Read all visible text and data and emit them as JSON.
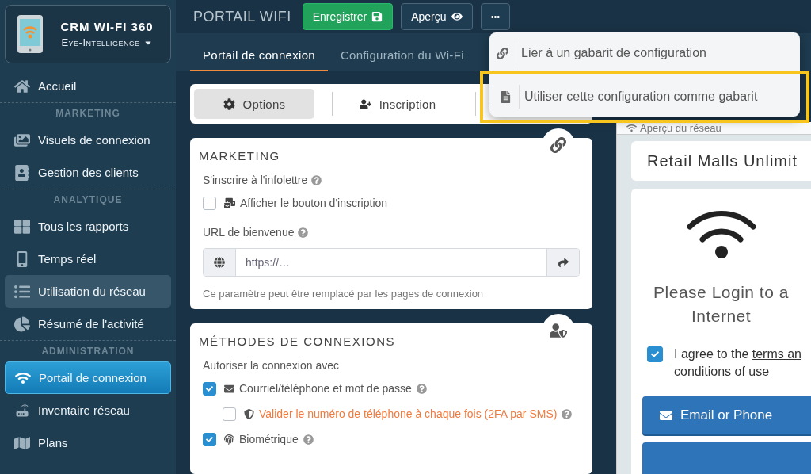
{
  "sidebar": {
    "brand": {
      "title": "CRM WI-FI 360",
      "org": "Eye-Intelligence"
    },
    "items": [
      {
        "kind": "item",
        "label": "Accueil",
        "selected": false,
        "hovered": false
      },
      {
        "kind": "section",
        "label": "MARKETING"
      },
      {
        "kind": "item",
        "label": "Visuels de connexion",
        "selected": false,
        "hovered": false
      },
      {
        "kind": "item",
        "label": "Gestion des clients",
        "selected": false,
        "hovered": false
      },
      {
        "kind": "section",
        "label": "ANALYTIQUE"
      },
      {
        "kind": "item",
        "label": "Tous les rapports",
        "selected": false,
        "hovered": false
      },
      {
        "kind": "item",
        "label": "Temps réel",
        "selected": false,
        "hovered": false
      },
      {
        "kind": "item",
        "label": "Utilisation du réseau",
        "selected": false,
        "hovered": true
      },
      {
        "kind": "item",
        "label": "Résumé de l'activité",
        "selected": false,
        "hovered": false
      },
      {
        "kind": "section",
        "label": "ADMINISTRATION"
      },
      {
        "kind": "item",
        "label": "Portail de connexion",
        "selected": true,
        "hovered": false
      },
      {
        "kind": "item",
        "label": "Inventaire réseau",
        "selected": false,
        "hovered": false
      },
      {
        "kind": "item",
        "label": "Plans",
        "selected": false,
        "hovered": false
      }
    ]
  },
  "header": {
    "title": "PORTAIL WIFI",
    "buttons": [
      {
        "kind": "save",
        "label": "Enregistrer"
      },
      {
        "kind": "preview",
        "label": "Aperçu"
      },
      {
        "kind": "more"
      }
    ]
  },
  "tabs": [
    {
      "label": "Portail de connexion",
      "selected": true
    },
    {
      "label": "Configuration du Wi-Fi",
      "selected": false
    }
  ],
  "menu": {
    "items": [
      {
        "label": "Lier à un gabarit de configuration",
        "highlighted": false
      },
      {
        "label": "Utiliser cette configuration comme gabarit",
        "highlighted": true
      }
    ]
  },
  "segments": [
    {
      "label": "Options",
      "selected": true
    },
    {
      "label": "Inscription",
      "selected": false
    }
  ],
  "marketing": {
    "title": "MARKETING",
    "newsletter_label": "S'inscrire à l'infolettre",
    "newsletter_checkbox": {
      "label": "Afficher le bouton d'inscription",
      "checked": false
    },
    "url_label": "URL de bienvenue",
    "url_field": {
      "placeholder": "https://…"
    },
    "hint": "Ce paramètre peut être remplacé par les pages de connexion"
  },
  "methods": {
    "title": "MÉTHODES DE CONNEXIONS",
    "intro": "Autoriser la connexion avec",
    "options": [
      {
        "kind": "email",
        "label": "Courriel/téléphone et mot de passe",
        "checked": true,
        "children": [
          {
            "kind": "shield",
            "label": "Valider le numéro de téléphone à chaque fois (2FA par SMS)",
            "checked": false
          }
        ]
      },
      {
        "kind": "biometric",
        "label": "Biométrique",
        "checked": true
      }
    ]
  },
  "preview": {
    "title": "Aperçu du réseau",
    "venue": "Retail Malls Unlimit",
    "login_lines": [
      "Please Login to a",
      "Internet"
    ],
    "agree": {
      "checked": true,
      "text": "I agree to the",
      "links": [
        "terms an",
        "conditions of use"
      ]
    },
    "buttons": [
      "Email or Phone"
    ]
  }
}
